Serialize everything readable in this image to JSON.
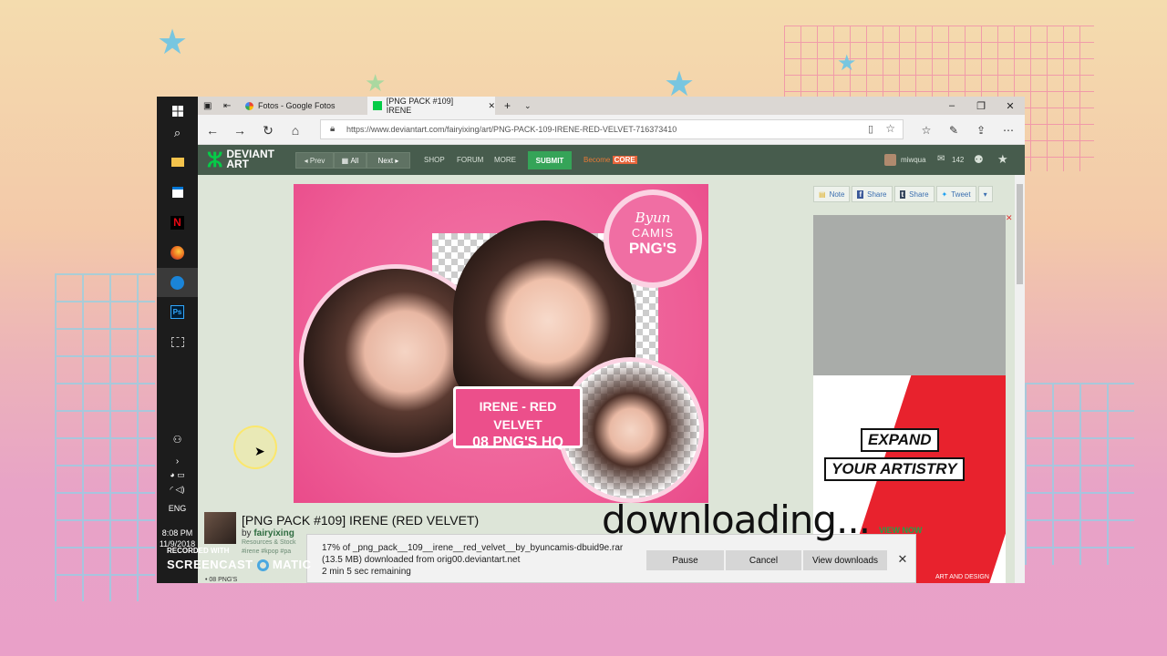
{
  "overlay": {
    "caption": "downloading..."
  },
  "watermark": {
    "line1": "RECORDED WITH",
    "line2": "SCREENCAST",
    "line2b": "MATIC"
  },
  "taskbar": {
    "time": "8:08 PM",
    "date": "11/9/2018",
    "lang": "ENG",
    "icons": [
      "windows-icon",
      "search-icon",
      "file-explorer-icon",
      "store-icon",
      "netflix-icon",
      "firefox-icon",
      "edge-icon",
      "photoshop-icon",
      "snip-icon"
    ],
    "photoshop_label": "Ps",
    "netflix_label": "N"
  },
  "browser": {
    "tabs": [
      {
        "label": "Fotos - Google Fotos",
        "icon": "google-photos-icon"
      },
      {
        "label": "[PNG PACK #109] IRENE",
        "icon": "deviantart-icon"
      }
    ],
    "url": "https://www.deviantart.com/fairyixing/art/PNG-PACK-109-IRENE-RED-VELVET-716373410"
  },
  "da_header": {
    "logo_line1": "DEVIANT",
    "logo_line2": "ART",
    "prev": "Prev",
    "all": "All",
    "next": "Next",
    "nav": [
      "SHOP",
      "FORUM",
      "MORE"
    ],
    "submit": "SUBMIT",
    "become": "Become",
    "core": "CORE",
    "username": "miwqua",
    "message_count": "142"
  },
  "artwork": {
    "badge_line1": "IRENE - RED VELVET",
    "badge_line2": "08 PNG'S HQ",
    "camis_line1": "Byun",
    "camis_line2": "CAMIS",
    "camis_line3": "PNG'S",
    "title": "[PNG PACK #109] IRENE (RED VELVET)",
    "by": "by",
    "author": "fairyixing",
    "category": "Resources & Stock",
    "tags": "#irene #kpop #pa",
    "detail": "• 08 PNG'S"
  },
  "sidebar": {
    "share_buttons": [
      "Note",
      "Share",
      "Share",
      "Tweet"
    ],
    "ad_line1": "EXPAND",
    "ad_line2": "YOUR ARTISTRY",
    "ad_cta": "VIEW NOW",
    "ad_footer": "ART AND DESIGN"
  },
  "download": {
    "line1": "17% of _png_pack__109__irene__red_velvet__by_byuncamis-dbuid9e.rar",
    "line2": "(13.5 MB) downloaded from orig00.deviantart.net",
    "line3": "2 min 5 sec remaining",
    "pause": "Pause",
    "cancel": "Cancel",
    "view": "View downloads",
    "progress": 0.17
  }
}
